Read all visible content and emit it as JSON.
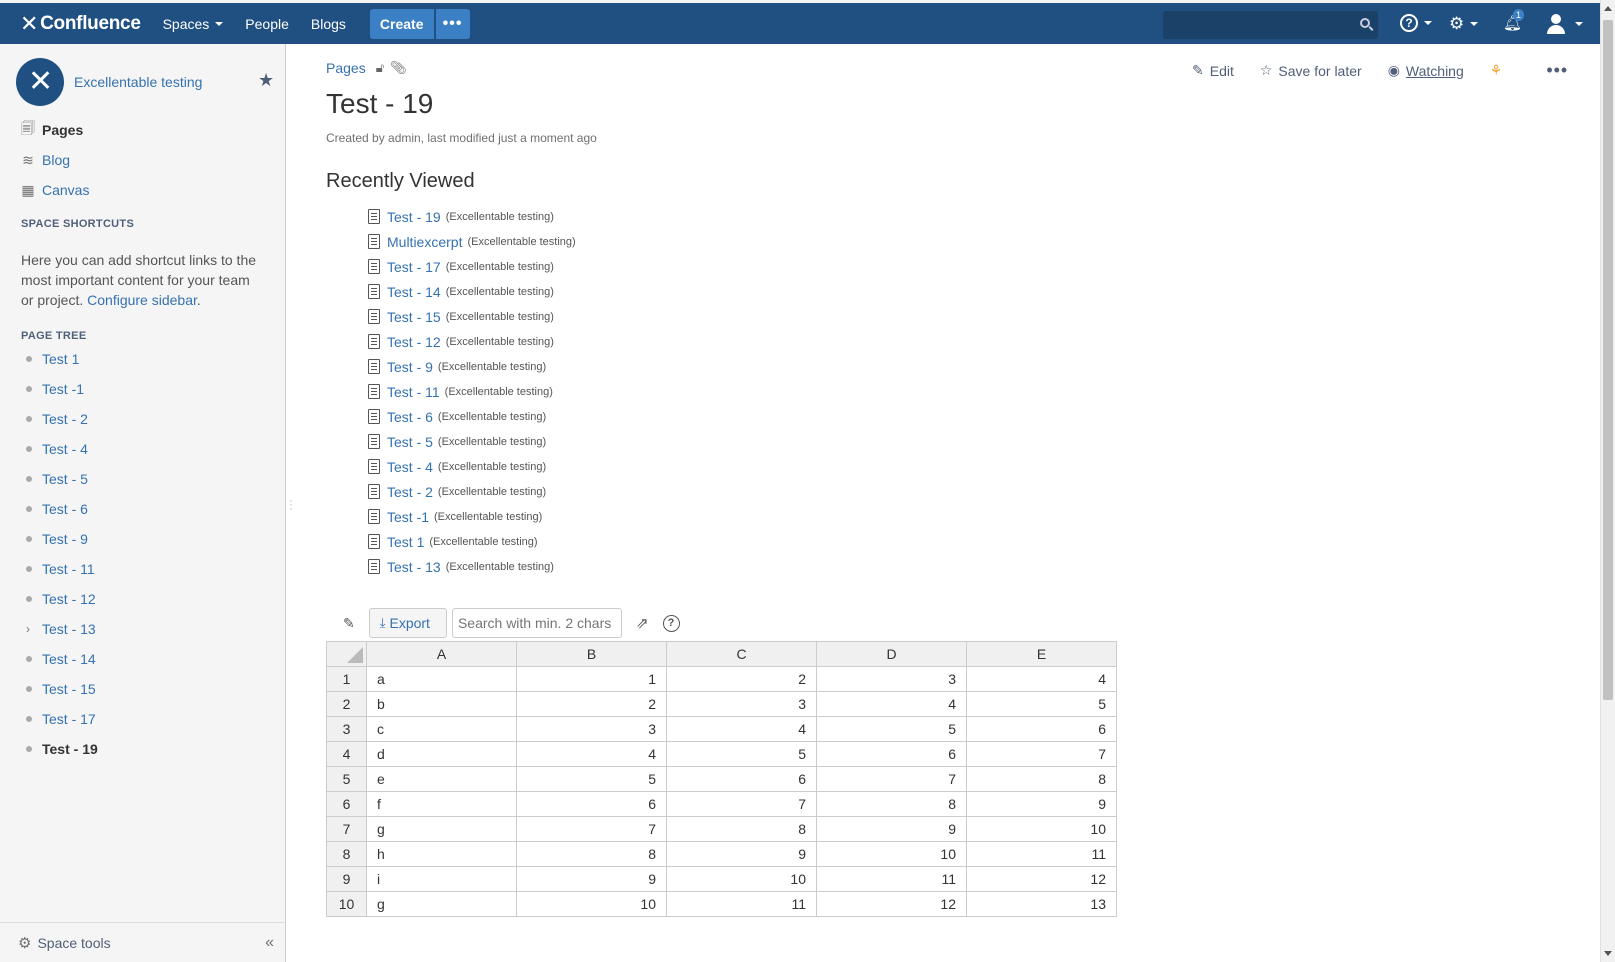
{
  "topbar": {
    "brand": "Confluence",
    "nav": [
      "Spaces",
      "People",
      "Blogs"
    ],
    "create_label": "Create",
    "more_label": "•••",
    "notification_count": "1"
  },
  "sidebar": {
    "space_name": "Excellentable testing",
    "nav": [
      {
        "label": "Pages",
        "icon": "pages-icon"
      },
      {
        "label": "Blog",
        "icon": "blog-icon"
      },
      {
        "label": "Canvas",
        "icon": "canvas-icon"
      }
    ],
    "shortcuts_heading": "SPACE SHORTCUTS",
    "shortcuts_text": "Here you can add shortcut links to the most important content for your team or project.",
    "configure_link": "Configure sidebar",
    "configure_suffix": ".",
    "tree_heading": "PAGE TREE",
    "tree": [
      {
        "label": "Test 1"
      },
      {
        "label": "Test -1"
      },
      {
        "label": "Test - 2"
      },
      {
        "label": "Test - 4"
      },
      {
        "label": "Test - 5"
      },
      {
        "label": "Test - 6"
      },
      {
        "label": "Test - 9"
      },
      {
        "label": "Test - 11"
      },
      {
        "label": "Test - 12"
      },
      {
        "label": "Test - 13",
        "expandable": true
      },
      {
        "label": "Test - 14"
      },
      {
        "label": "Test - 15"
      },
      {
        "label": "Test - 17"
      },
      {
        "label": "Test - 19",
        "current": true
      }
    ],
    "space_tools": "Space tools"
  },
  "page": {
    "breadcrumb": "Pages",
    "actions": {
      "edit": "Edit",
      "save": "Save for later",
      "watch": "Watching"
    },
    "title": "Test - 19",
    "meta": "Created by admin, last modified just a moment ago",
    "recent_heading": "Recently Viewed",
    "recent": [
      {
        "title": "Test - 19",
        "space": "(Excellentable testing)"
      },
      {
        "title": "Multiexcerpt",
        "space": "(Excellentable testing)"
      },
      {
        "title": "Test - 17",
        "space": "(Excellentable testing)"
      },
      {
        "title": "Test - 14",
        "space": "(Excellentable testing)"
      },
      {
        "title": "Test - 15",
        "space": "(Excellentable testing)"
      },
      {
        "title": "Test - 12",
        "space": "(Excellentable testing)"
      },
      {
        "title": "Test - 9",
        "space": "(Excellentable testing)"
      },
      {
        "title": "Test - 11",
        "space": "(Excellentable testing)"
      },
      {
        "title": "Test - 6",
        "space": "(Excellentable testing)"
      },
      {
        "title": "Test - 5",
        "space": "(Excellentable testing)"
      },
      {
        "title": "Test - 4",
        "space": "(Excellentable testing)"
      },
      {
        "title": "Test - 2",
        "space": "(Excellentable testing)"
      },
      {
        "title": "Test -1",
        "space": "(Excellentable testing)"
      },
      {
        "title": "Test 1",
        "space": "(Excellentable testing)"
      },
      {
        "title": "Test - 13",
        "space": "(Excellentable testing)"
      }
    ]
  },
  "sheet": {
    "export_label": "Export",
    "search_placeholder": "Search with min. 2 chars",
    "columns": [
      "A",
      "B",
      "C",
      "D",
      "E"
    ],
    "rows": [
      [
        "1",
        "a",
        "1",
        "2",
        "3",
        "4"
      ],
      [
        "2",
        "b",
        "2",
        "3",
        "4",
        "5"
      ],
      [
        "3",
        "c",
        "3",
        "4",
        "5",
        "6"
      ],
      [
        "4",
        "d",
        "4",
        "5",
        "6",
        "7"
      ],
      [
        "5",
        "e",
        "5",
        "6",
        "7",
        "8"
      ],
      [
        "6",
        "f",
        "6",
        "7",
        "8",
        "9"
      ],
      [
        "7",
        "g",
        "7",
        "8",
        "9",
        "10"
      ],
      [
        "8",
        "h",
        "8",
        "9",
        "10",
        "11"
      ],
      [
        "9",
        "i",
        "9",
        "10",
        "11",
        "12"
      ],
      [
        "10",
        "g",
        "10",
        "11",
        "12",
        "13"
      ]
    ]
  },
  "colors": {
    "nav_bg": "#205081",
    "link": "#3572b0",
    "create_bg": "#3b7fc4"
  }
}
